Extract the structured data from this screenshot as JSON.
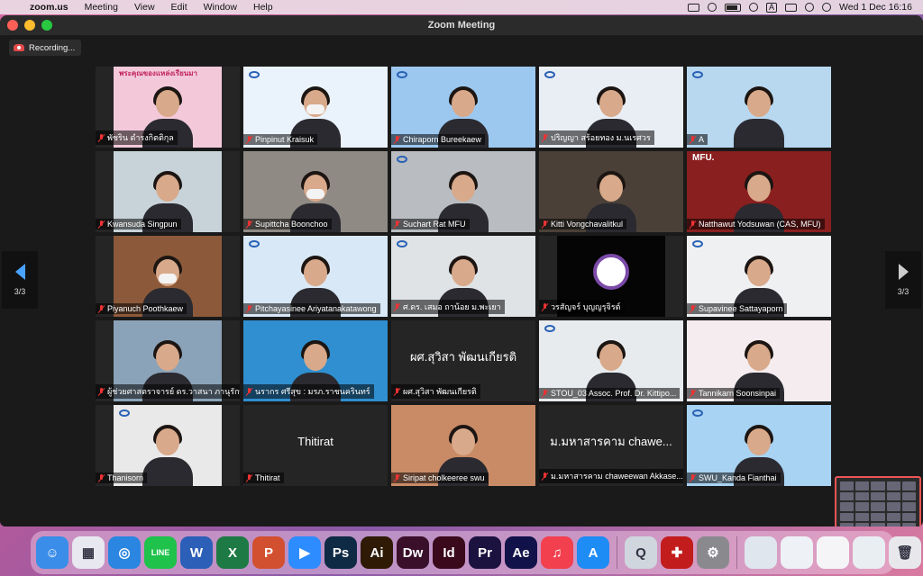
{
  "menubar": {
    "app": "zoom.us",
    "items": [
      "Meeting",
      "View",
      "Edit",
      "Window",
      "Help"
    ],
    "input_letter": "A",
    "datetime": "Wed 1 Dec  16:16"
  },
  "window": {
    "title": "Zoom Meeting",
    "recording_label": "Recording...",
    "page_left": "3/3",
    "page_right": "3/3"
  },
  "participants": [
    {
      "name": "พัชริน ดำรงกิตติกุล",
      "video": "person",
      "bg": "#f3c9da",
      "banner": "พระคุณของแหล่งเรียนมา"
    },
    {
      "name": "Pinpinut Kraisuk",
      "video": "person",
      "bg": "#eaf2fb",
      "mask": true
    },
    {
      "name": "Chiraporn Bureekaew",
      "video": "person",
      "bg": "#9cc8f0"
    },
    {
      "name": "ปริญญา สร้อยทอง ม.นเรศวร",
      "video": "person",
      "bg": "#e9eef5"
    },
    {
      "name": "A",
      "video": "person",
      "bg": "#b8d8f0"
    },
    {
      "name": "Kwansuda Singpun",
      "video": "person",
      "bg": "#c7d3d8"
    },
    {
      "name": "Supittcha Boonchoo",
      "video": "person",
      "bg": "#8f8a84",
      "mask": true
    },
    {
      "name": "Suchart Rat MFU",
      "video": "person",
      "bg": "#b9bcc0"
    },
    {
      "name": "Kitti Vongchavalitkul",
      "video": "person",
      "bg": "#4a4038"
    },
    {
      "name": "Natthawut Yodsuwan (CAS, MFU)",
      "video": "person",
      "bg": "#8a1f1f",
      "banner": "MFU."
    },
    {
      "name": "Piyanuch Poothkaew",
      "video": "person",
      "bg": "#8c5a3a",
      "mask": true
    },
    {
      "name": "Pitchayasinee Ariyatanakatawong",
      "video": "person",
      "bg": "#d9e8f6"
    },
    {
      "name": "ศ.ดร. เสมอ ถาน้อย ม.พะเยา",
      "video": "person",
      "bg": "#dfe3e6"
    },
    {
      "name": "วรสัญจร์ บุญญรุจิรต์",
      "video": "logo",
      "bg": "#050505"
    },
    {
      "name": "Supavinee Sattayaporn",
      "video": "person",
      "bg": "#eef0f2"
    },
    {
      "name": "ผู้ช่วยศาสตราจารย์ ดร.วาสนา ภานุรักษ์",
      "video": "person",
      "bg": "#8aa3b8"
    },
    {
      "name": "นรากร ศรีสุข : มรภ.ราชนครินทร์",
      "video": "person",
      "bg": "#2f8fd0"
    },
    {
      "name": "ผศ.สุวิสา พัฒนเกียรติ",
      "video": "none",
      "display": "ผศ.สุวิสา พัฒนเกียรติ"
    },
    {
      "name": "STOU_03 Assoc. Prof. Dr. Kittipo...",
      "video": "person",
      "bg": "#e7ebee"
    },
    {
      "name": "Tannikarn Soonsinpai",
      "video": "person",
      "bg": "#f5ecef"
    },
    {
      "name": "Thanisorn",
      "video": "person",
      "bg": "#e9e9e9"
    },
    {
      "name": "Thitirat",
      "video": "none",
      "display": "Thitirat"
    },
    {
      "name": "Siripat cholkeeree swu",
      "video": "person",
      "bg": "#c98a66"
    },
    {
      "name": "ม.มหาสารคาม chaweewan Akkase...",
      "video": "none",
      "display": "ม.มหาสารคาม chawe..."
    },
    {
      "name": "SWU_Kanda Fianthai",
      "video": "person",
      "bg": "#a8d3f2"
    }
  ],
  "dock": [
    {
      "name": "finder",
      "color": "#3a8de8",
      "glyph": "☺"
    },
    {
      "name": "launchpad",
      "color": "#e8e8f0",
      "glyph": "▦"
    },
    {
      "name": "safari",
      "color": "#2a86e0",
      "glyph": "◎"
    },
    {
      "name": "line",
      "color": "#1fc24a",
      "glyph": "LINE"
    },
    {
      "name": "word",
      "color": "#2b5fb8",
      "glyph": "W"
    },
    {
      "name": "excel",
      "color": "#1e7a44",
      "glyph": "X"
    },
    {
      "name": "powerpoint",
      "color": "#d2502f",
      "glyph": "P"
    },
    {
      "name": "zoom",
      "color": "#2d8cff",
      "glyph": "▶"
    },
    {
      "name": "photoshop",
      "color": "#0f2a45",
      "glyph": "Ps"
    },
    {
      "name": "illustrator",
      "color": "#2e1a05",
      "glyph": "Ai"
    },
    {
      "name": "dreamweaver",
      "color": "#3a0f2a",
      "glyph": "Dw"
    },
    {
      "name": "indesign",
      "color": "#3a0a1c",
      "glyph": "Id"
    },
    {
      "name": "premiere",
      "color": "#1c1240",
      "glyph": "Pr"
    },
    {
      "name": "after-effects",
      "color": "#12124a",
      "glyph": "Ae"
    },
    {
      "name": "music",
      "color": "#f2404f",
      "glyph": "♫"
    },
    {
      "name": "app-store",
      "color": "#1e8cf5",
      "glyph": "A"
    },
    {
      "name": "quicktime",
      "color": "#cfd6de",
      "glyph": "Q"
    },
    {
      "name": "acrobat",
      "color": "#c21c1c",
      "glyph": "✚"
    },
    {
      "name": "system-preferences",
      "color": "#8a8a8e",
      "glyph": "⚙"
    },
    {
      "name": "doc-1",
      "color": "#dfe6ee",
      "glyph": ""
    },
    {
      "name": "doc-2",
      "color": "#eef1f5",
      "glyph": ""
    },
    {
      "name": "doc-3",
      "color": "#f5f5f7",
      "glyph": ""
    },
    {
      "name": "doc-4",
      "color": "#e9eef3",
      "glyph": ""
    },
    {
      "name": "trash",
      "color": "#e8e8ec",
      "glyph": "🗑"
    }
  ]
}
